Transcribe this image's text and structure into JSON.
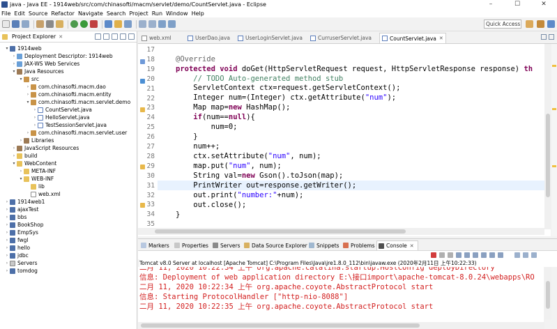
{
  "window": {
    "title": "java - Java EE - 1914web/src/com/chinasofti/macm/servlet/demo/CountServlet.java - Eclipse",
    "controls": [
      "–",
      "☐",
      "✕"
    ]
  },
  "menubar": {
    "items": [
      "File",
      "Edit",
      "Source",
      "Refactor",
      "Navigate",
      "Search",
      "Project",
      "Run",
      "Window",
      "Help"
    ]
  },
  "toolbar": {
    "quick_access": "Quick Access"
  },
  "explorer": {
    "title": "Project Explorer",
    "close": "✕",
    "tree": [
      {
        "label": "1914web",
        "arrow": "▾",
        "icon": "project"
      },
      {
        "label": "Deployment Descriptor: 1914web",
        "arrow": "›",
        "icon": "web"
      },
      {
        "label": "JAX-WS Web Services",
        "arrow": "›",
        "icon": "web"
      },
      {
        "label": "Java Resources",
        "arrow": "▾",
        "icon": "lib"
      },
      {
        "label": "src",
        "arrow": "▾",
        "icon": "pkg"
      },
      {
        "label": "com.chinasofti.macm.dao",
        "arrow": "›",
        "icon": "pkg"
      },
      {
        "label": "com.chinasofti.macm.entity",
        "arrow": "›",
        "icon": "pkg"
      },
      {
        "label": "com.chinasofti.macm.servlet.demo",
        "arrow": "▾",
        "icon": "pkg"
      },
      {
        "label": "CountServlet.java",
        "arrow": "›",
        "icon": "java"
      },
      {
        "label": "HelloServlet.java",
        "arrow": "›",
        "icon": "java"
      },
      {
        "label": "TestSessionServlet.java",
        "arrow": "›",
        "icon": "java"
      },
      {
        "label": "com.chinasofti.macm.servlet.user",
        "arrow": "›",
        "icon": "pkg"
      },
      {
        "label": "Libraries",
        "arrow": "›",
        "icon": "lib"
      },
      {
        "label": "JavaScript Resources",
        "arrow": "›",
        "icon": "lib"
      },
      {
        "label": "build",
        "arrow": "›",
        "icon": "folder"
      },
      {
        "label": "WebContent",
        "arrow": "▾",
        "icon": "folder"
      },
      {
        "label": "META-INF",
        "arrow": "›",
        "icon": "folder"
      },
      {
        "label": "WEB-INF",
        "arrow": "▾",
        "icon": "folder"
      },
      {
        "label": "lib",
        "arrow": "",
        "icon": "folder"
      },
      {
        "label": "web.xml",
        "arrow": "",
        "icon": "xml"
      },
      {
        "label": "1914web1",
        "arrow": "›",
        "icon": "project"
      },
      {
        "label": "ajaxTest",
        "arrow": "›",
        "icon": "project"
      },
      {
        "label": "bbs",
        "arrow": "›",
        "icon": "project"
      },
      {
        "label": "BookShop",
        "arrow": "›",
        "icon": "project"
      },
      {
        "label": "EmpSys",
        "arrow": "›",
        "icon": "project"
      },
      {
        "label": "fwgl",
        "arrow": "›",
        "icon": "project"
      },
      {
        "label": "hello",
        "arrow": "›",
        "icon": "project"
      },
      {
        "label": "jdbc",
        "arrow": "›",
        "icon": "project"
      },
      {
        "label": "Servers",
        "arrow": "›",
        "icon": "srv"
      },
      {
        "label": "tomdog",
        "arrow": "›",
        "icon": "project"
      }
    ]
  },
  "editor": {
    "tabs": [
      {
        "label": "web.xml",
        "active": false
      },
      {
        "label": "UserDao.java",
        "active": false
      },
      {
        "label": "UserLoginServlet.java",
        "active": false
      },
      {
        "label": "CurruserServlet.java",
        "active": false
      },
      {
        "label": "CountServlet.java",
        "active": true
      }
    ],
    "line_numbers": [
      "17",
      "18",
      "19",
      "20",
      "21",
      "22",
      "23",
      "24",
      "25",
      "26",
      "27",
      "28",
      "29",
      "30",
      "31",
      "32",
      "33",
      "34",
      "35"
    ]
  },
  "console": {
    "tabs": [
      "Markers",
      "Properties",
      "Servers",
      "Data Source Explorer",
      "Snippets",
      "Problems",
      "Console"
    ],
    "active_tab": "Console",
    "description": "Tomcat v8.0 Server at localhost [Apache Tomcat] C:\\Program Files\\Java\\jre1.8.0_112\\bin\\javaw.exe (2020年2月11日 上午10:22:33)",
    "lines": [
      "二月 11, 2020 10:22:34 上午 org.apache.catalina.startup.HostConfig deployDirectory",
      "信息: Deployment of web application directory E:\\接口import\\apache-tomcat-8.0.24\\webapps\\RO",
      "二月 11, 2020 10:22:34 上午 org.apache.coyote.AbstractProtocol start",
      "信息: Starting ProtocolHandler [\"http-nio-8088\"]",
      "二月 11, 2020 10:22:35 上午 org.apache.coyote.AbstractProtocol start"
    ]
  }
}
